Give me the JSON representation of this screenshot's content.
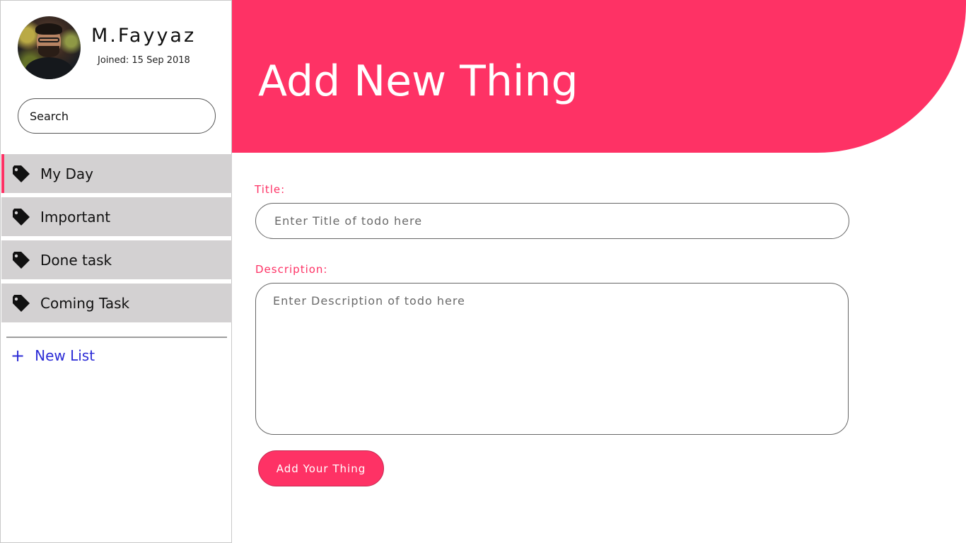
{
  "user": {
    "name": "M.Fayyaz",
    "joined": "Joined: 15 Sep 2018"
  },
  "search": {
    "placeholder": "Search"
  },
  "nav": {
    "items": [
      {
        "label": "My Day",
        "icon": "tag-icon",
        "active": true
      },
      {
        "label": "Important",
        "icon": "tag-icon"
      },
      {
        "label": "Done task",
        "icon": "tag-icon"
      },
      {
        "label": "Coming Task",
        "icon": "tag-icon"
      }
    ],
    "new_list": {
      "icon": "plus-icon",
      "label": "New List"
    }
  },
  "header": {
    "title": "Add New Thing"
  },
  "form": {
    "title_label": "Title:",
    "title_placeholder": "Enter Title of todo here",
    "description_label": "Description:",
    "description_placeholder": "Enter Description of todo here",
    "submit_label": "Add Your Thing"
  },
  "colors": {
    "accent": "#fe3265",
    "nav_bg": "#d3d1d2",
    "link": "#2b2bd6"
  }
}
